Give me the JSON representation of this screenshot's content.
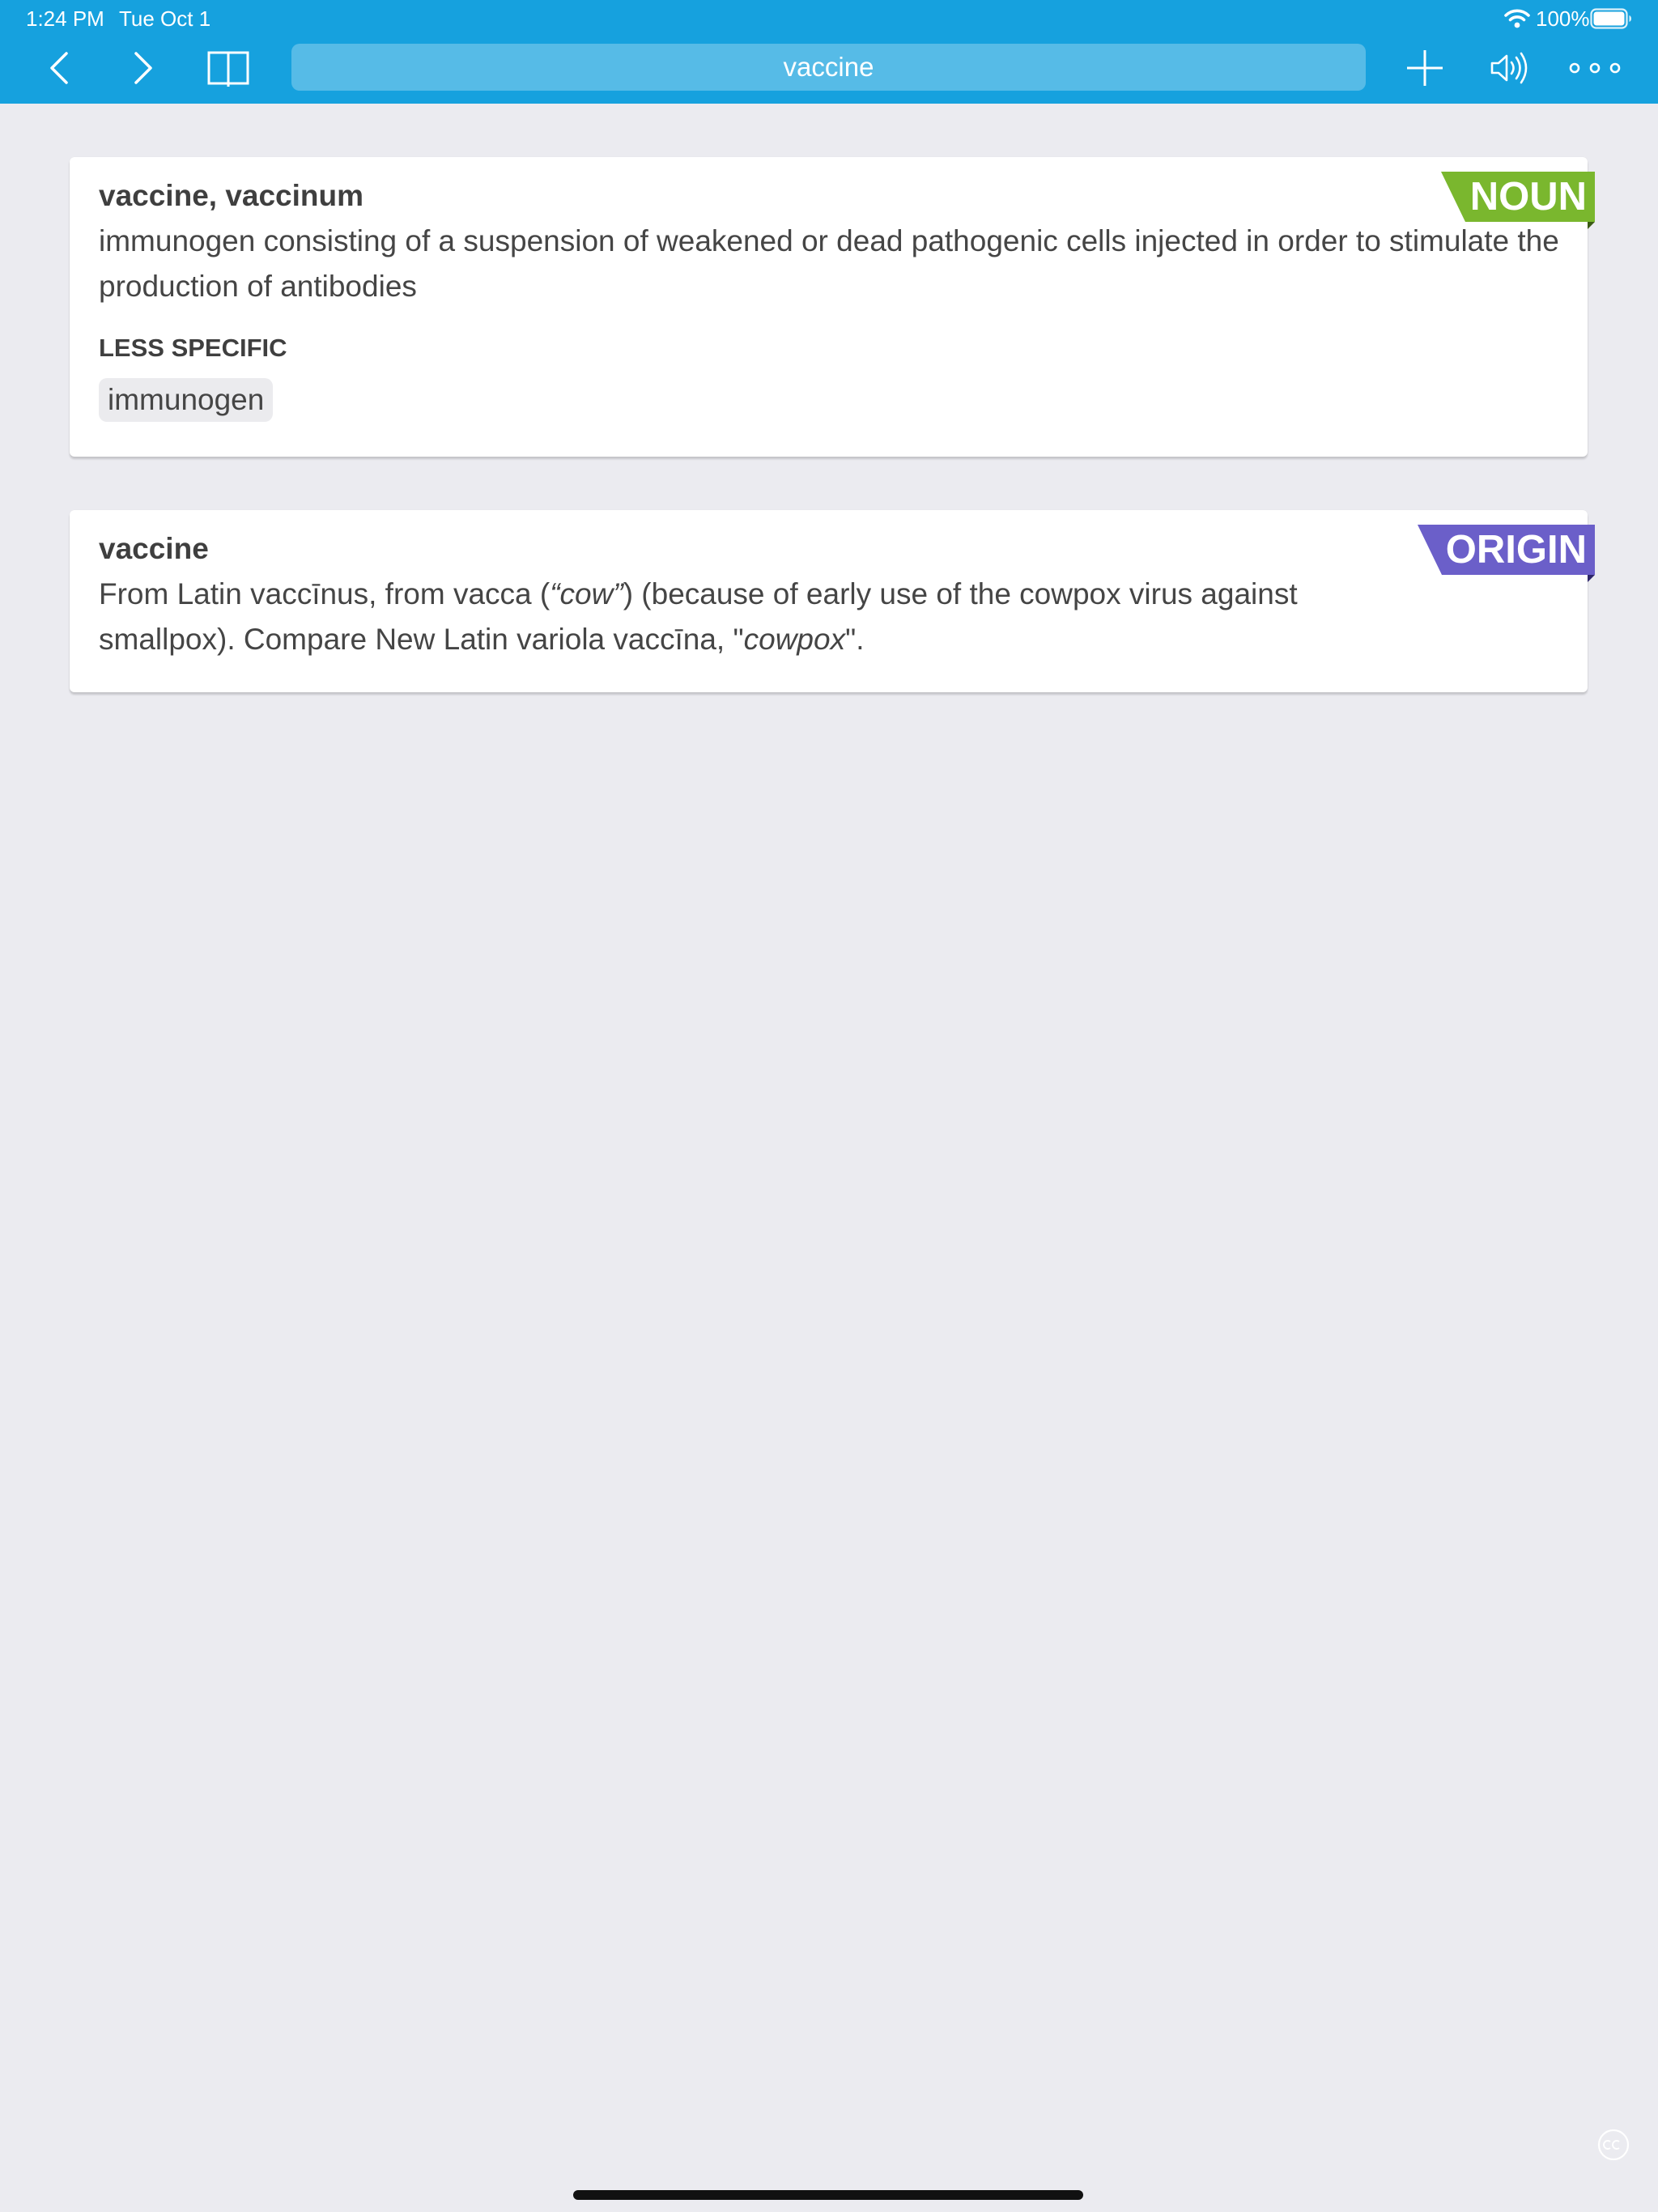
{
  "status_bar": {
    "time": "1:24 PM",
    "date": "Tue Oct 1",
    "battery": "100%"
  },
  "toolbar": {
    "search_value": "vaccine",
    "icons": [
      "back-chevron-icon",
      "forward-chevron-icon",
      "book-icon",
      "plus-icon",
      "speaker-icon",
      "more-dots-icon"
    ]
  },
  "entries": [
    {
      "badge": "NOUN",
      "badge_color": "#7ab72e",
      "title": "vaccine, vaccinum",
      "definition": "immunogen consisting of a suspension of weakened or dead pathogenic cells injected in order to stimulate the production of antibodies",
      "related_heading": "LESS SPECIFIC",
      "related": [
        "immunogen"
      ]
    },
    {
      "badge": "ORIGIN",
      "badge_color": "#6b5fc9",
      "title": "vaccine",
      "etymology": {
        "part1": "From Latin vaccīnus, from vacca (",
        "italic1": "“cow”",
        "part2": ") (because of early use of the cowpox virus against smallpox). Compare New Latin variola vaccīna, \"",
        "italic2": "cowpox",
        "part3": "\"."
      }
    }
  ],
  "colors": {
    "header": "#16a1de",
    "background": "#ebebf0",
    "noun_badge": "#7ab72e",
    "origin_badge": "#6b5fc9"
  }
}
